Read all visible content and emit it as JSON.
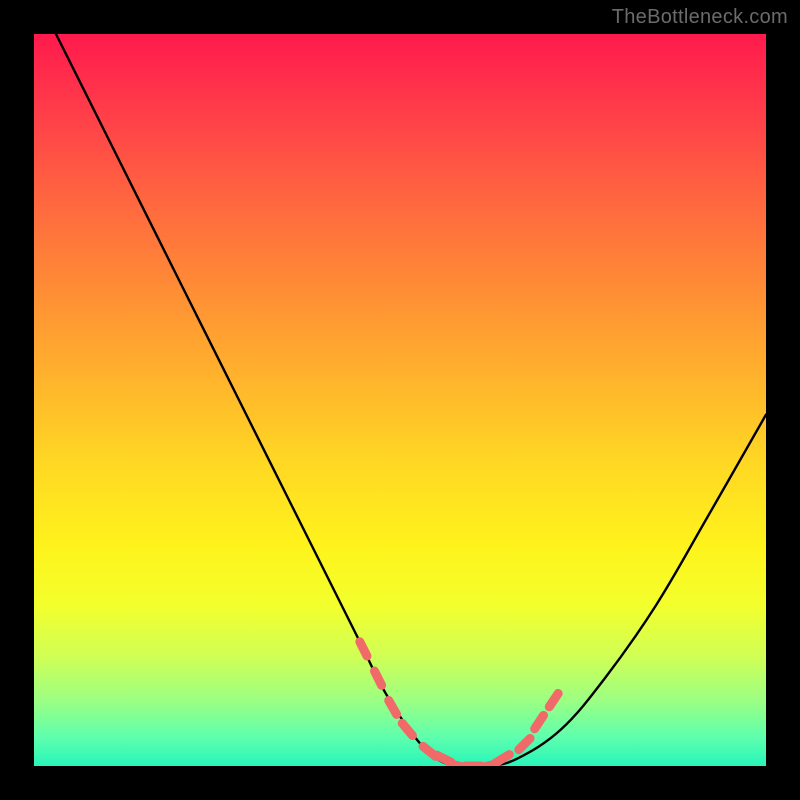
{
  "watermark": "TheBottleneck.com",
  "colors": {
    "page_bg": "#000000",
    "gradient_top": "#ff1a4d",
    "gradient_bottom": "#28f5b9",
    "curve": "#000000",
    "marker": "#f06a6a"
  },
  "chart_data": {
    "type": "line",
    "title": "",
    "xlabel": "",
    "ylabel": "",
    "xlim": [
      0,
      100
    ],
    "ylim": [
      0,
      100
    ],
    "grid": false,
    "legend": false,
    "series": [
      {
        "name": "curve",
        "x": [
          3,
          8,
          14,
          20,
          26,
          32,
          38,
          44,
          48,
          52,
          55,
          58,
          62,
          66,
          72,
          78,
          85,
          92,
          100
        ],
        "y": [
          100,
          90,
          78,
          66,
          54,
          42,
          30,
          18,
          10,
          4,
          1,
          0,
          0,
          1,
          5,
          12,
          22,
          34,
          48
        ]
      }
    ],
    "markers": {
      "name": "highlight-points",
      "x": [
        45,
        47,
        49,
        51,
        54,
        56,
        58,
        60,
        62,
        64,
        67,
        69,
        71
      ],
      "y": [
        16,
        12,
        8,
        5,
        2,
        1,
        0,
        0,
        0,
        1,
        3,
        6,
        9
      ]
    }
  }
}
